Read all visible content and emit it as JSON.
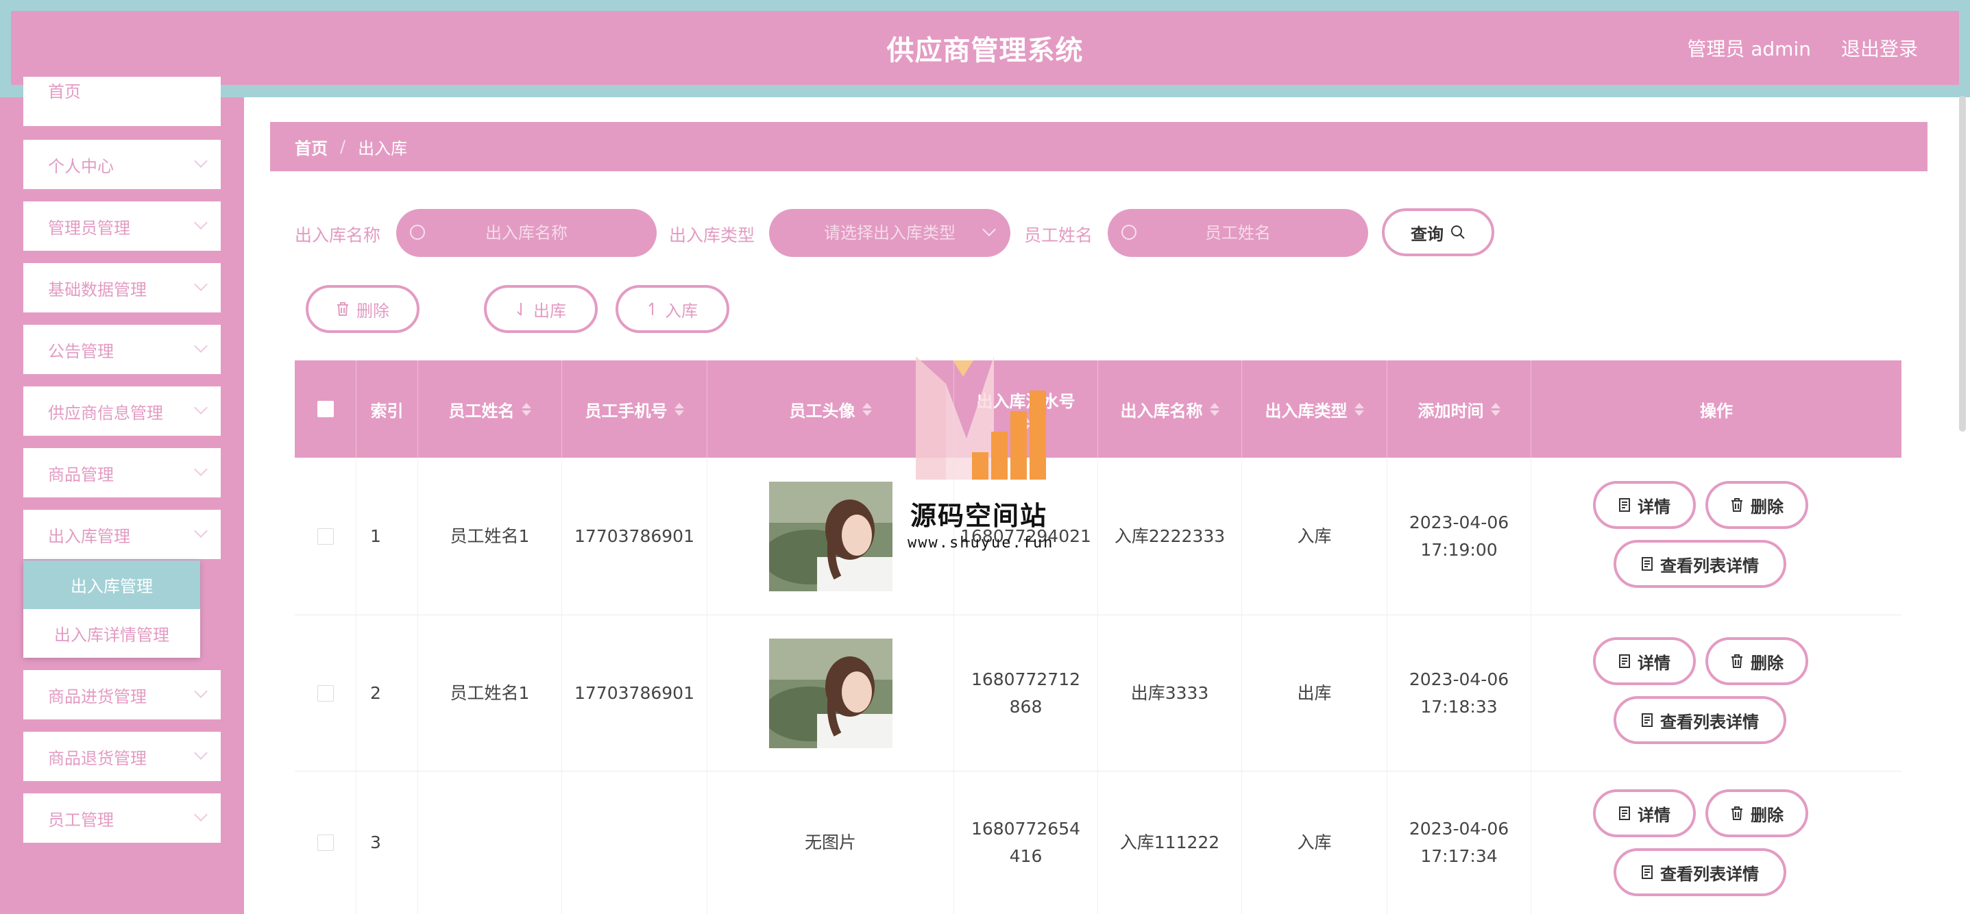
{
  "header": {
    "title": "供应商管理系统",
    "user": "管理员 admin",
    "logout": "退出登录"
  },
  "sidebar": {
    "items": [
      {
        "label": "首页"
      },
      {
        "label": "个人中心"
      },
      {
        "label": "管理员管理"
      },
      {
        "label": "基础数据管理"
      },
      {
        "label": "公告管理"
      },
      {
        "label": "供应商信息管理"
      },
      {
        "label": "商品管理"
      },
      {
        "label": "出入库管理"
      },
      {
        "label": "商品进货管理"
      },
      {
        "label": "商品退货管理"
      },
      {
        "label": "员工管理"
      }
    ],
    "submenu": [
      {
        "label": "出入库管理",
        "active": true
      },
      {
        "label": "出入库详情管理"
      }
    ]
  },
  "breadcrumb": {
    "home": "首页",
    "sep": "/",
    "current": "出入库"
  },
  "search": {
    "name_label": "出入库名称",
    "name_placeholder": "出入库名称",
    "type_label": "出入库类型",
    "type_placeholder": "请选择出入库类型",
    "staff_label": "员工姓名",
    "staff_placeholder": "员工姓名",
    "query_button": "查询"
  },
  "toolbar": {
    "delete": "删除",
    "out": "出库",
    "in": "入库"
  },
  "table": {
    "columns": [
      "索引",
      "员工姓名",
      "员工手机号",
      "员工头像",
      "出入库流水号",
      "出入库名称",
      "出入库类型",
      "添加时间",
      "操作"
    ],
    "rows": [
      {
        "index": "1",
        "name": "员工姓名1",
        "phone": "17703786901",
        "avatar": "photo",
        "serial": "168077294021",
        "title": "入库2222333",
        "type": "入库",
        "time": "2023-04-06 17:19:00"
      },
      {
        "index": "2",
        "name": "员工姓名1",
        "phone": "17703786901",
        "avatar": "photo",
        "serial": "1680772712868",
        "title": "出库3333",
        "type": "出库",
        "time": "2023-04-06 17:18:33"
      },
      {
        "index": "3",
        "name": "",
        "phone": "",
        "avatar": "无图片",
        "serial": "1680772654416",
        "title": "入库111222",
        "type": "入库",
        "time": "2023-04-06 17:17:34"
      }
    ],
    "actions": {
      "detail": "详情",
      "delete": "删除",
      "list_detail": "查看列表详情"
    }
  },
  "watermark": {
    "text": "源码空间站",
    "url": "www.shuyue.fun"
  },
  "colors": {
    "accent": "#e39bc3",
    "teal": "#a4d1d6"
  }
}
